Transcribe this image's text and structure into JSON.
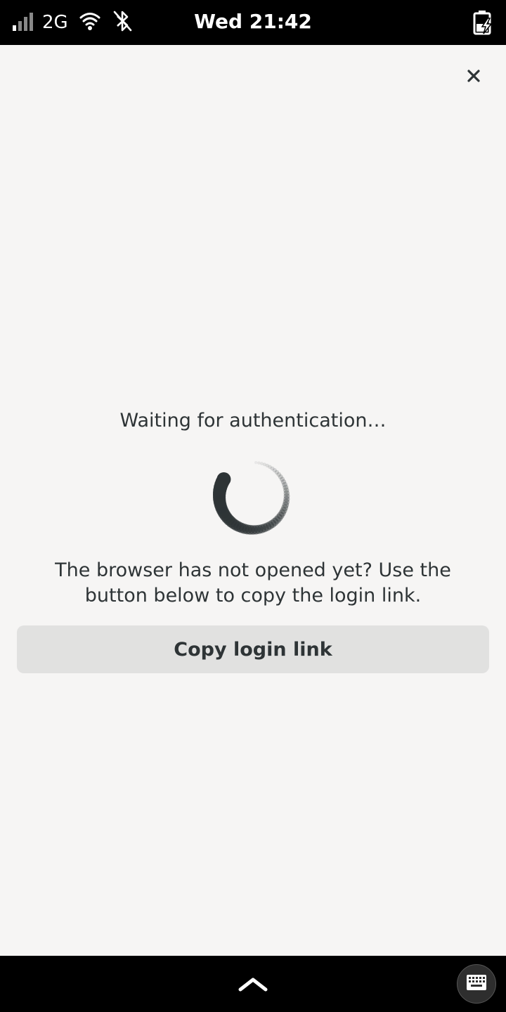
{
  "status_bar": {
    "network_type": "2G",
    "clock": "Wed 21:42",
    "icons": [
      "signal-icon",
      "wifi-icon",
      "bluetooth-disabled-icon",
      "battery-charging-icon"
    ]
  },
  "dialog": {
    "close_icon": "close-icon",
    "waiting_text": "Waiting for authentication…",
    "info_text": "The browser has not opened yet? Use the button below to copy the login link.",
    "copy_button_label": "Copy login link"
  },
  "bottom_bar": {
    "icons": [
      "chevron-up-icon",
      "keyboard-icon"
    ]
  },
  "colors": {
    "background": "#f6f5f4",
    "text": "#2e3436",
    "button": "#e1e1e0",
    "bars": "#000000"
  }
}
